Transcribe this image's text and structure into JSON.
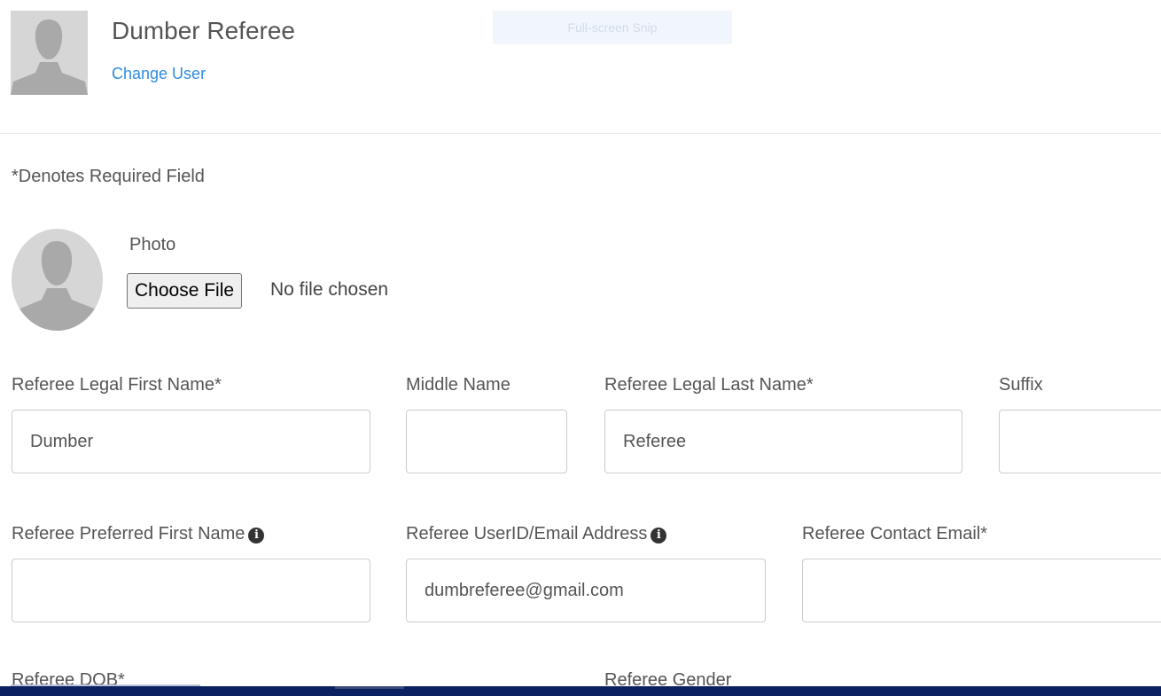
{
  "header": {
    "user_name": "Dumber Referee",
    "change_user": "Change User",
    "snip_label": "Full-screen Snip"
  },
  "form": {
    "required_note": "*Denotes Required Field",
    "photo": {
      "label": "Photo",
      "choose_button": "Choose File",
      "status": "No file chosen"
    },
    "first_name": {
      "label": "Referee Legal First Name*",
      "value": "Dumber"
    },
    "middle_name": {
      "label": "Middle Name",
      "value": ""
    },
    "last_name": {
      "label": "Referee Legal Last Name*",
      "value": "Referee"
    },
    "suffix": {
      "label": "Suffix",
      "value": ""
    },
    "preferred_name": {
      "label": "Referee Preferred First Name",
      "value": "",
      "icon": "info-circle-icon"
    },
    "userid_email": {
      "label": "Referee UserID/Email Address",
      "value": "dumbreferee@gmail.com",
      "icon": "info-circle-icon"
    },
    "contact_email": {
      "label": "Referee Contact Email*",
      "value": ""
    },
    "dob": {
      "label": "Referee DOB*"
    },
    "gender": {
      "label": "Referee Gender"
    }
  },
  "colors": {
    "link": "#2f8be0",
    "text": "#555555",
    "taskbar": "#0b2060"
  }
}
